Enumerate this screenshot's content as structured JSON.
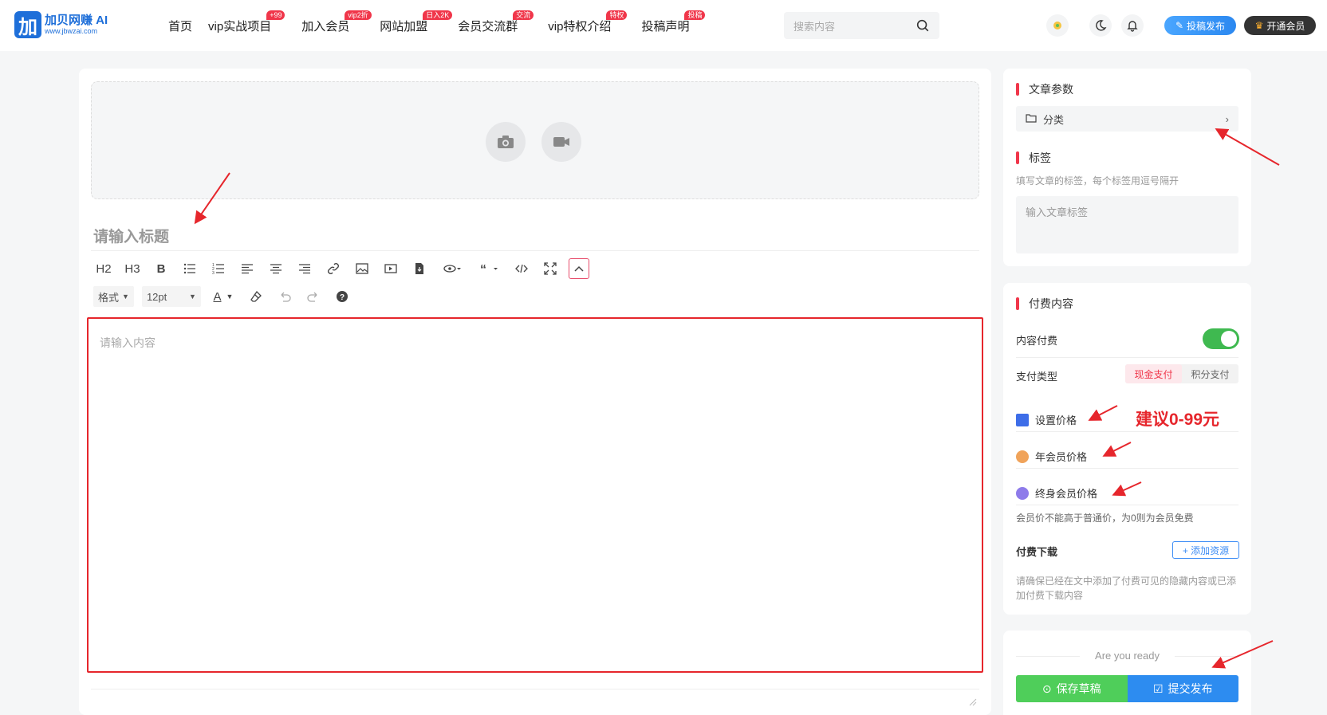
{
  "header": {
    "logo_name": "加贝网赚 AI",
    "logo_url": "www.jbwzai.com",
    "nav": [
      {
        "label": "首页",
        "badge": ""
      },
      {
        "label": "vip实战项目",
        "badge": "+99"
      },
      {
        "label": "加入会员",
        "badge": "vip2折"
      },
      {
        "label": "网站加盟",
        "badge": "日入2K"
      },
      {
        "label": "会员交流群",
        "badge": "交流"
      },
      {
        "label": "vip特权介绍",
        "badge": "特权"
      },
      {
        "label": "投稿声明",
        "badge": "投稿"
      }
    ],
    "search_placeholder": "搜索内容",
    "post_button": "投稿发布",
    "vip_button": "开通会员"
  },
  "editor": {
    "title_placeholder": "请输入标题",
    "content_placeholder": "请输入内容",
    "toolbar": {
      "h2": "H2",
      "h3": "H3",
      "bold": "B",
      "format": "格式",
      "font_size": "12pt",
      "font_color": "A"
    }
  },
  "article_params": {
    "title": "文章参数",
    "category": "分类",
    "tags_title": "标签",
    "tags_hint": "填写文章的标签，每个标签用逗号隔开",
    "tags_placeholder": "输入文章标签"
  },
  "paid": {
    "title": "付费内容",
    "content_paid": "内容付费",
    "toggle_on": true,
    "pay_type": "支付类型",
    "pay_cash": "现金支付",
    "pay_points": "积分支付",
    "set_price": "设置价格",
    "annual_price": "年会员价格",
    "lifetime_price": "终身会员价格",
    "member_hint": "会员价不能高于普通价，为0则为会员免费",
    "paid_download": "付费下载",
    "add_resource": "+ 添加资源",
    "download_hint": "请确保已经在文中添加了付费可见的隐藏内容或已添加付费下载内容"
  },
  "publish": {
    "ready": "Are you ready",
    "save_draft": "保存草稿",
    "submit": "提交发布"
  },
  "annotation": {
    "price_suggestion": "建议0-99元"
  },
  "colors": {
    "accent": "#f0364a",
    "brand": "#1e6fd9",
    "highlight": "#e6262c",
    "green": "#4fce5a",
    "blue": "#2d8cf0"
  }
}
